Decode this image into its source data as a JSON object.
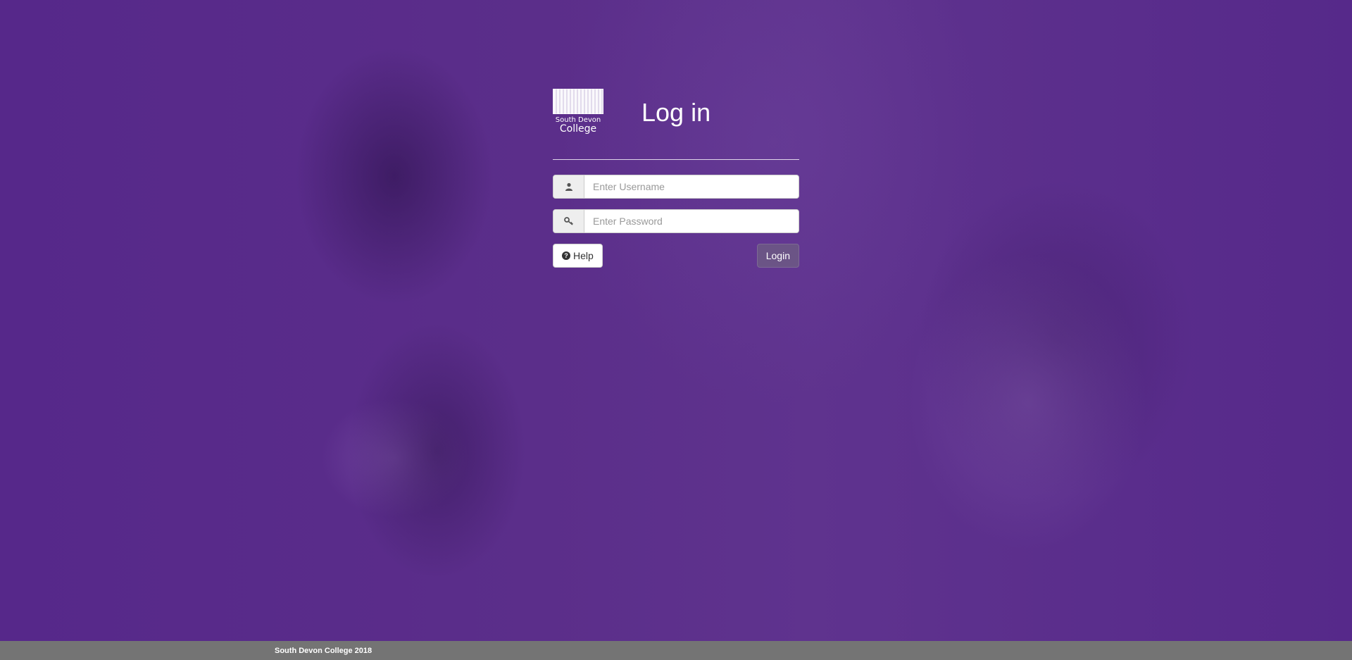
{
  "header": {
    "logo_subtitle": "South Devon",
    "logo_title": "College",
    "title": "Log in"
  },
  "form": {
    "username_placeholder": "Enter Username",
    "password_placeholder": "Enter Password",
    "username_icon": "user-icon",
    "password_icon": "key-icon",
    "help_label": "Help",
    "help_icon": "question-circle-icon",
    "login_label": "Login"
  },
  "footer": {
    "text": "South Devon College 2018"
  },
  "colors": {
    "background": "#5a2d86",
    "footer": "#747474",
    "login_button": "#6b5486"
  }
}
